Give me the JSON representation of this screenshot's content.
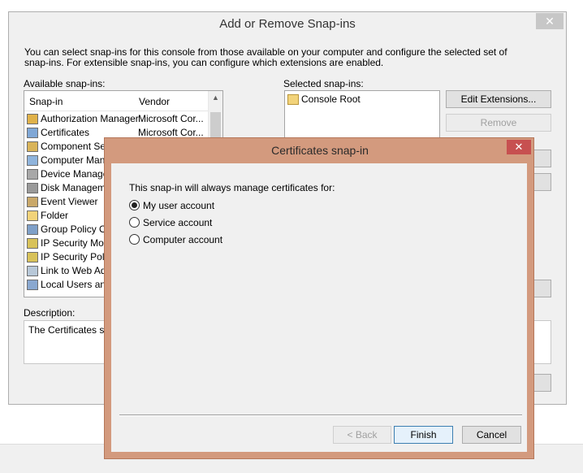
{
  "outer_dialog": {
    "title": "Add or Remove Snap-ins",
    "close_glyph": "✕",
    "description": "You can select snap-ins for this console from those available on your computer and configure the selected set of snap-ins. For extensible snap-ins, you can configure which extensions are enabled.",
    "available_label": "Available snap-ins:",
    "selected_label": "Selected snap-ins:",
    "columns": [
      "Snap-in",
      "Vendor"
    ],
    "available_items": [
      {
        "label": "Authorization Manager",
        "vendor": "Microsoft Cor...",
        "icon": "authorization-icon"
      },
      {
        "label": "Certificates",
        "vendor": "Microsoft Cor...",
        "icon": "certificates-icon"
      },
      {
        "label": "Component Serv",
        "vendor": "",
        "icon": "component-icon"
      },
      {
        "label": "Computer Mana",
        "vendor": "",
        "icon": "computer-icon"
      },
      {
        "label": "Device Managem",
        "vendor": "",
        "icon": "device-icon"
      },
      {
        "label": "Disk Manageme",
        "vendor": "",
        "icon": "disk-icon"
      },
      {
        "label": "Event Viewer",
        "vendor": "",
        "icon": "event-viewer-icon"
      },
      {
        "label": "Folder",
        "vendor": "",
        "icon": "folder-icon"
      },
      {
        "label": "Group Policy Ob",
        "vendor": "",
        "icon": "policy-icon"
      },
      {
        "label": "IP Security Mon",
        "vendor": "",
        "icon": "ip-security-icon"
      },
      {
        "label": "IP Security Polic",
        "vendor": "",
        "icon": "ip-security-icon"
      },
      {
        "label": "Link to Web Add",
        "vendor": "",
        "icon": "link-icon"
      },
      {
        "label": "Local Users and",
        "vendor": "",
        "icon": "users-icon"
      }
    ],
    "selected_items": [
      {
        "label": "Console Root",
        "icon": "folder-icon"
      }
    ],
    "edit_extensions_label": "Edit Extensions...",
    "remove_label": "Remove",
    "description_label": "Description:",
    "description_text": "The Certificates sna"
  },
  "modal": {
    "title": "Certificates snap-in",
    "close_glyph": "✕",
    "prompt": "This snap-in will always manage certificates for:",
    "options": [
      {
        "label": "My user account",
        "checked": true
      },
      {
        "label": "Service account",
        "checked": false
      },
      {
        "label": "Computer account",
        "checked": false
      }
    ],
    "back_label": "< Back",
    "finish_label": "Finish",
    "cancel_label": "Cancel"
  },
  "colors": {
    "modal_frame": "#d39a7e",
    "close_red": "#c75050",
    "dialog_bg": "#f0f0f0"
  }
}
